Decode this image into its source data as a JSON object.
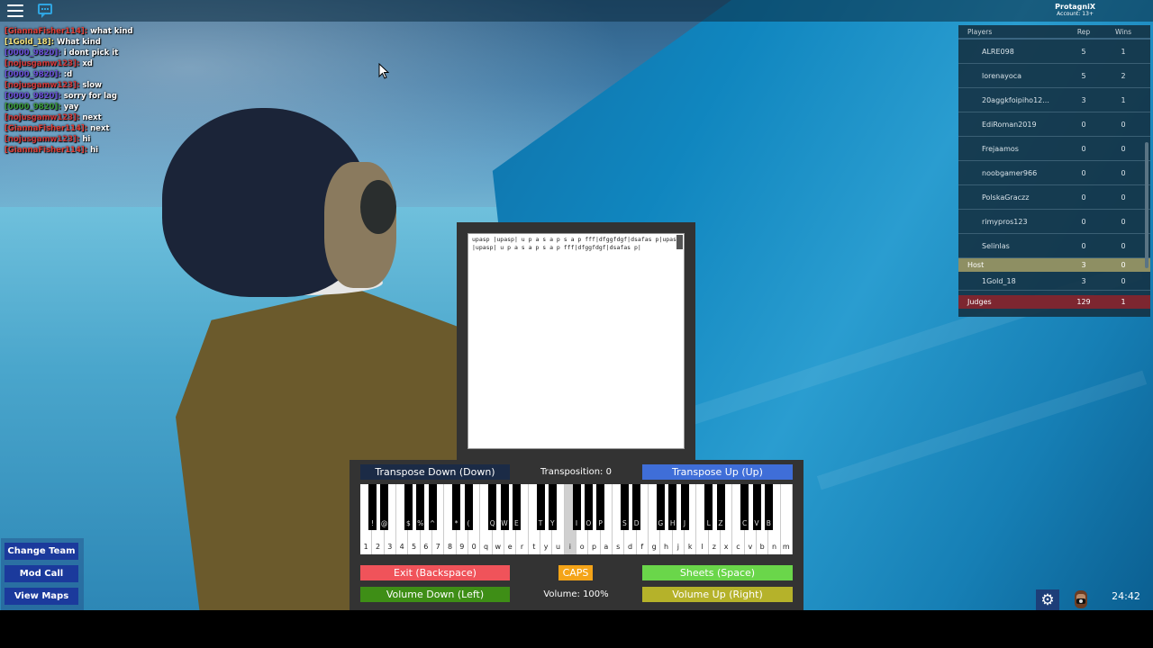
{
  "topbar": {
    "menu_icon": "hamburger-menu-icon",
    "chat_icon": "chat-bubble-icon",
    "account_name": "ProtagniX",
    "account_age": "Account: 13+"
  },
  "chat": [
    {
      "user": "[GiannaFisher114]:",
      "msg": " what kind",
      "color": "#e0403a"
    },
    {
      "user": "[1Gold_18]:",
      "msg": " What kind",
      "color": "#f3e27a"
    },
    {
      "user": "[0000_9820]:",
      "msg": " i dont pick it",
      "color": "#6a4fd8"
    },
    {
      "user": "[nojusgamw123]:",
      "msg": " xd",
      "color": "#d0383a"
    },
    {
      "user": "[0000_9820]:",
      "msg": " :d",
      "color": "#6a4fd8"
    },
    {
      "user": "[nojusgamw123]:",
      "msg": " slow",
      "color": "#d0383a"
    },
    {
      "user": "[0000_9820]:",
      "msg": " sorry for lag",
      "color": "#6a4fd8"
    },
    {
      "user": "[0000_9820]:",
      "msg": " yay",
      "color": "#3a9a3a"
    },
    {
      "user": "[nojusgamw123]:",
      "msg": " next",
      "color": "#d0383a"
    },
    {
      "user": "[GiannaFisher114]:",
      "msg": " next",
      "color": "#e0403a"
    },
    {
      "user": "[nojusgamw123]:",
      "msg": " hi",
      "color": "#d0383a"
    },
    {
      "user": "[GiannaFisher114]:",
      "msg": " hi",
      "color": "#e0403a"
    }
  ],
  "leaderboard": {
    "headers": {
      "players": "Players",
      "rep": "Rep",
      "wins": "Wins"
    },
    "players": [
      {
        "name": "ALRE098",
        "rep": "5",
        "wins": "1"
      },
      {
        "name": "lorenayoca",
        "rep": "5",
        "wins": "2"
      },
      {
        "name": "20aggkfoipiho12...",
        "rep": "3",
        "wins": "1"
      },
      {
        "name": "EdiRoman2019",
        "rep": "0",
        "wins": "0"
      },
      {
        "name": "Frejaamos",
        "rep": "0",
        "wins": "0"
      },
      {
        "name": "noobgamer966",
        "rep": "0",
        "wins": "0"
      },
      {
        "name": "PolskaGraczz",
        "rep": "0",
        "wins": "0"
      },
      {
        "name": "rimypros123",
        "rep": "0",
        "wins": "0"
      },
      {
        "name": "Selinlas",
        "rep": "0",
        "wins": "0"
      }
    ],
    "host_team": {
      "name": "Host",
      "rep": "3",
      "wins": "0",
      "color": "#8e8f63"
    },
    "host_players": [
      {
        "name": "1Gold_18",
        "rep": "3",
        "wins": "0"
      }
    ],
    "judges_team": {
      "name": "Judges",
      "rep": "129",
      "wins": "1",
      "color": "#7d2630"
    }
  },
  "sheet": {
    "text": "upasp |upasp| u p a s a p s a p fff|dfggfdgf|dsafas p|upasp |upasp| u p a s a p s a p fff|dfggfdgf|dsafas p|"
  },
  "piano": {
    "transpose_down": "Transpose Down (Down)",
    "transpose_up": "Transpose Up (Up)",
    "transposition": "Transposition: 0",
    "white_keys": [
      "1",
      "2",
      "3",
      "4",
      "5",
      "6",
      "7",
      "8",
      "9",
      "0",
      "q",
      "w",
      "e",
      "r",
      "t",
      "y",
      "u",
      "i",
      "o",
      "p",
      "a",
      "s",
      "d",
      "f",
      "g",
      "h",
      "j",
      "k",
      "l",
      "z",
      "x",
      "c",
      "v",
      "b",
      "n",
      "m"
    ],
    "active_white_key": "i",
    "black_keys": [
      {
        "after": 0,
        "label": "!"
      },
      {
        "after": 1,
        "label": "@"
      },
      {
        "after": 3,
        "label": "$"
      },
      {
        "after": 4,
        "label": "%"
      },
      {
        "after": 5,
        "label": "^"
      },
      {
        "after": 7,
        "label": "*"
      },
      {
        "after": 8,
        "label": "("
      },
      {
        "after": 10,
        "label": "Q"
      },
      {
        "after": 11,
        "label": "W"
      },
      {
        "after": 12,
        "label": "E"
      },
      {
        "after": 14,
        "label": "T"
      },
      {
        "after": 15,
        "label": "Y"
      },
      {
        "after": 17,
        "label": "I"
      },
      {
        "after": 18,
        "label": "O"
      },
      {
        "after": 19,
        "label": "P"
      },
      {
        "after": 21,
        "label": "S"
      },
      {
        "after": 22,
        "label": "D"
      },
      {
        "after": 24,
        "label": "G"
      },
      {
        "after": 25,
        "label": "H"
      },
      {
        "after": 26,
        "label": "J"
      },
      {
        "after": 28,
        "label": "L"
      },
      {
        "after": 29,
        "label": "Z"
      },
      {
        "after": 31,
        "label": "C"
      },
      {
        "after": 32,
        "label": "V"
      },
      {
        "after": 33,
        "label": "B"
      }
    ],
    "exit": "Exit (Backspace)",
    "caps": "CAPS",
    "sheets": "Sheets (Space)",
    "volume_down": "Volume Down (Left)",
    "volume_up": "Volume Up (Right)",
    "volume": "Volume: 100%",
    "colors": {
      "exit": "#f0535a",
      "caps": "#f4a418",
      "sheets": "#6ad64a",
      "volume_down": "#3e8e16",
      "volume_up": "#b5b22a",
      "transpose_up": "#3f6ed8",
      "transpose_down": "#1b2b46"
    }
  },
  "left_menu": {
    "change_team": "Change Team",
    "mod_call": "Mod Call",
    "view_maps": "View Maps"
  },
  "bottom_right": {
    "settings_icon": "gear-icon",
    "avatar_icon": "avatar-icon",
    "time": "24:42"
  }
}
